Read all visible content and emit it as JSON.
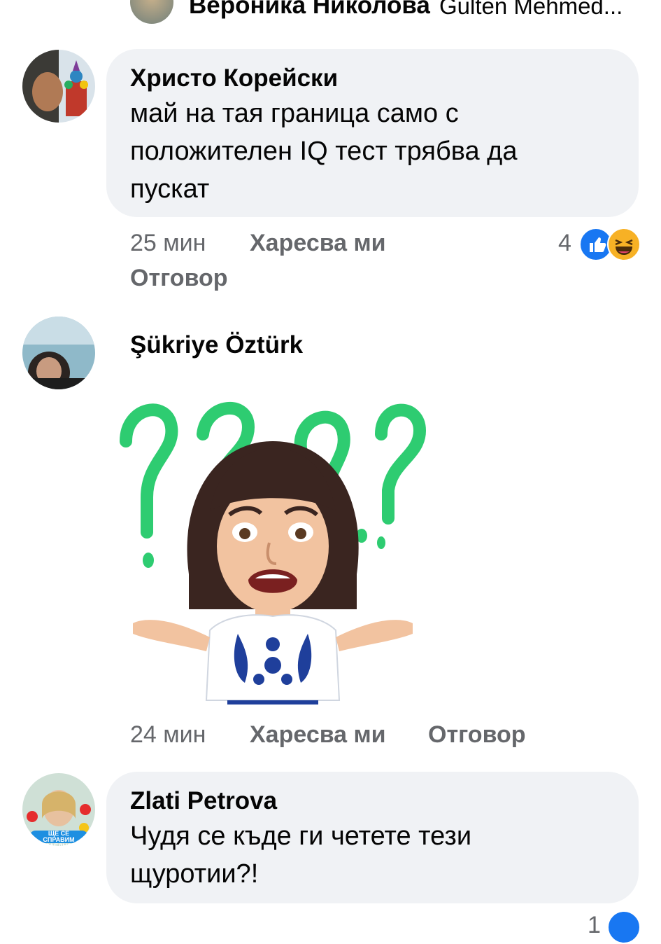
{
  "top_comment": {
    "author": "Вероника Николова",
    "tagged": "Gulten Mehmed..."
  },
  "comments": [
    {
      "author": "Христо Корейски",
      "lines": [
        "май на тая граница само с",
        "положителен IQ тест трябва да",
        "пускат"
      ],
      "time": "25 мин",
      "like_label": "Харесва ми",
      "reply_label": "Отговор",
      "reactions_count": "4",
      "reaction_icons": [
        "like-icon",
        "laugh-icon"
      ]
    },
    {
      "author": "Şükriye Öztürk",
      "sticker": "confused-woman-sticker",
      "time": "24 мин",
      "like_label": "Харесва ми",
      "reply_label": "Отговор"
    },
    {
      "author": "Zlati Petrova",
      "lines": [
        "Чудя се къде ги четете тези",
        "щуротии?!"
      ],
      "avatar_caption": "ЩЕ СЕ СПРАВИМ ЗАЕДНО",
      "time": "",
      "like_label": "",
      "reply_label": "",
      "reactions_count": "1"
    }
  ],
  "colors": {
    "bubble": "#f0f2f5",
    "meta_text": "#65676b",
    "like_blue": "#1877f2",
    "laugh_yellow": "#f7b125",
    "sticker_green": "#2ecc71"
  }
}
